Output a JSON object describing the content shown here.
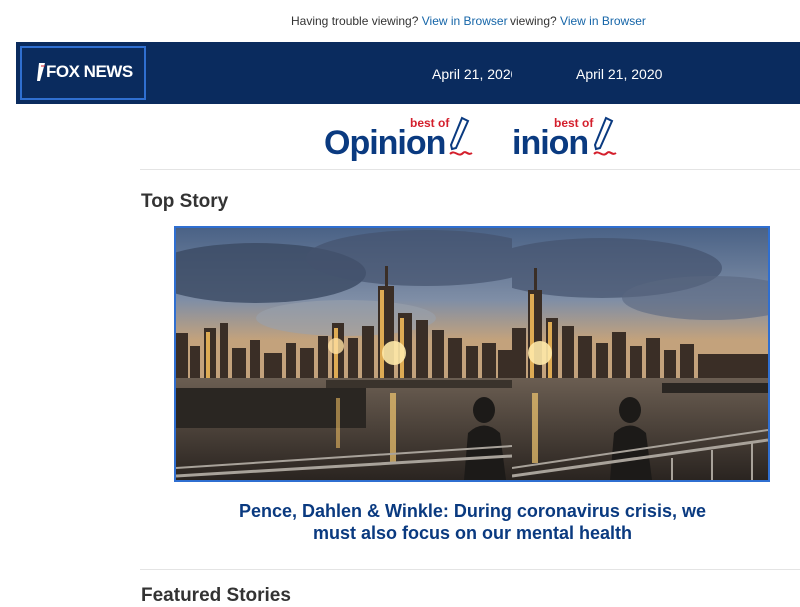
{
  "topbar": {
    "trouble_text": "Having trouble viewing?",
    "view_link": "View in Browser",
    "trouble_text_dup": "viewing?",
    "view_link_dup": "View in Browser"
  },
  "header": {
    "logo_text": "FOX NEWS",
    "date": "April 21, 2020",
    "date_dup": "April 21, 2020"
  },
  "opinion_logo": {
    "best_of": "best of",
    "word": "Opinion",
    "word_dup": "inion"
  },
  "top_story": {
    "section_title": "Top Story",
    "headline_line1": "Pence, Dahlen & Winkle: During coronavirus crisis, we",
    "headline_line2": "must also focus on our mental health"
  },
  "featured": {
    "section_title": "Featured Stories"
  },
  "colors": {
    "header_bg": "#0a2b5e",
    "link": "#1565a8",
    "headline": "#0a3a80",
    "accent_red": "#d41f2c"
  }
}
